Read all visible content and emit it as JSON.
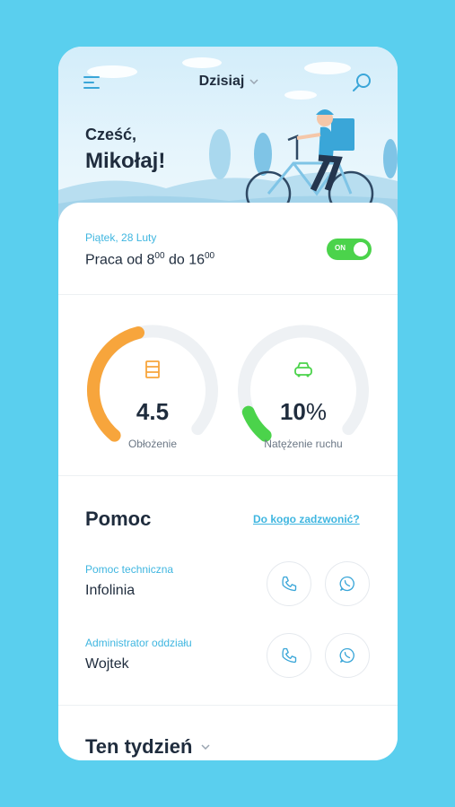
{
  "header": {
    "title": "Dzisiaj"
  },
  "greeting": {
    "line1": "Cześć,",
    "line2": "Mikołaj!"
  },
  "shift": {
    "date": "Piątek, 28 Luty",
    "prefix": "Praca od 8",
    "start_sup": "00",
    "mid": " do 16",
    "end_sup": "00",
    "toggle_label": "ON"
  },
  "gauges": [
    {
      "value": "4.5",
      "label": "Obłożenie",
      "fraction": 0.45,
      "color": "#f7a53c"
    },
    {
      "value_number": "10",
      "value_unit": "%",
      "label": "Natężenie ruchu",
      "fraction": 0.1,
      "color": "#4bd34b"
    }
  ],
  "help": {
    "title": "Pomoc",
    "link": "Do kogo zadzwonić?",
    "contacts": [
      {
        "category": "Pomoc techniczna",
        "name": "Infolinia"
      },
      {
        "category": "Administrator oddziału",
        "name": "Wojtek"
      }
    ]
  },
  "week": {
    "title": "Ten tydzień"
  },
  "colors": {
    "accent": "#3fb6e0",
    "background": "#5acfee",
    "toggle_on": "#4bd34b",
    "orange": "#f7a53c"
  },
  "icons": {
    "menu": "menu-icon",
    "search": "search-icon",
    "chevron": "chevron-down-icon",
    "phone": "phone-icon",
    "whatsapp": "whatsapp-icon"
  }
}
